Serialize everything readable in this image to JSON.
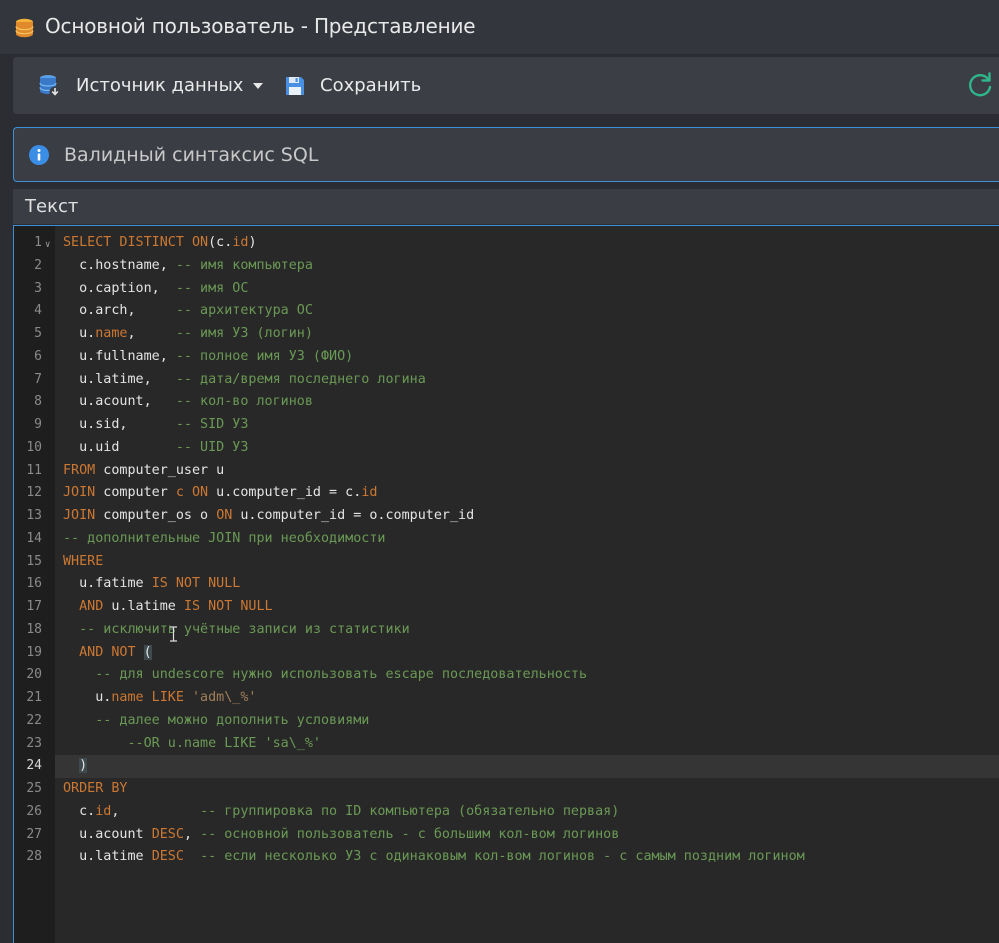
{
  "window": {
    "title": "Основной пользователь - Представление"
  },
  "toolbar": {
    "source_label": "Источник данных",
    "save_label": "Сохранить"
  },
  "info": {
    "message": "Валидный синтаксис SQL"
  },
  "panel": {
    "title": "Текст"
  },
  "editor": {
    "active_line": 24,
    "lines": [
      [
        [
          "kw",
          "SELECT DISTINCT ON"
        ],
        [
          "",
          "(c."
        ],
        [
          "kw",
          "id"
        ],
        [
          "",
          ")"
        ]
      ],
      [
        [
          "",
          "  c.hostname, "
        ],
        [
          "cm",
          "-- имя компьютера"
        ]
      ],
      [
        [
          "",
          "  o.caption,  "
        ],
        [
          "cm",
          "-- имя ОС"
        ]
      ],
      [
        [
          "",
          "  o.arch,     "
        ],
        [
          "cm",
          "-- архитектура ОС"
        ]
      ],
      [
        [
          "",
          "  u."
        ],
        [
          "kw",
          "name"
        ],
        [
          "",
          ",     "
        ],
        [
          "cm",
          "-- имя УЗ (логин)"
        ]
      ],
      [
        [
          "",
          "  u.fullname, "
        ],
        [
          "cm",
          "-- полное имя УЗ (ФИО)"
        ]
      ],
      [
        [
          "",
          "  u.latime,   "
        ],
        [
          "cm",
          "-- дата/время последнего логина"
        ]
      ],
      [
        [
          "",
          "  u.acount,   "
        ],
        [
          "cm",
          "-- кол-во логинов"
        ]
      ],
      [
        [
          "",
          "  u.sid,      "
        ],
        [
          "cm",
          "-- SID УЗ"
        ]
      ],
      [
        [
          "",
          "  u.uid       "
        ],
        [
          "cm",
          "-- UID УЗ"
        ]
      ],
      [
        [
          "kw",
          "FROM"
        ],
        [
          "",
          " computer_user u"
        ]
      ],
      [
        [
          "kw",
          "JOIN"
        ],
        [
          "",
          " computer "
        ],
        [
          "kw",
          "c ON"
        ],
        [
          "",
          " u.computer_id = c."
        ],
        [
          "kw",
          "id"
        ]
      ],
      [
        [
          "kw",
          "JOIN"
        ],
        [
          "",
          " computer_os o "
        ],
        [
          "kw",
          "ON"
        ],
        [
          "",
          " u.computer_id = o.computer_id"
        ]
      ],
      [
        [
          "cm",
          "-- дополнительные JOIN при необходимости"
        ]
      ],
      [
        [
          "kw",
          "WHERE"
        ]
      ],
      [
        [
          "",
          "  u.fatime "
        ],
        [
          "kw",
          "IS NOT NULL"
        ]
      ],
      [
        [
          "",
          "  "
        ],
        [
          "kw",
          "AND"
        ],
        [
          "",
          " u.latime "
        ],
        [
          "kw",
          "IS NOT NULL"
        ]
      ],
      [
        [
          "",
          "  "
        ],
        [
          "cm",
          "-- исключить учётные записи из статистики"
        ]
      ],
      [
        [
          "",
          "  "
        ],
        [
          "kw",
          "AND NOT"
        ],
        [
          "",
          " "
        ],
        [
          "br",
          "("
        ]
      ],
      [
        [
          "",
          "    "
        ],
        [
          "cm",
          "-- для undescore нужно использовать escape последовательность"
        ]
      ],
      [
        [
          "",
          "    u."
        ],
        [
          "kw",
          "name LIKE"
        ],
        [
          "",
          " "
        ],
        [
          "st",
          "'adm\\_%'"
        ]
      ],
      [
        [
          "",
          "    "
        ],
        [
          "cm",
          "-- далее можно дополнить условиями"
        ]
      ],
      [
        [
          "",
          "        "
        ],
        [
          "cm",
          "--OR u.name LIKE 'sa\\_%'"
        ]
      ],
      [
        [
          "",
          "  "
        ],
        [
          "br",
          ")"
        ]
      ],
      [
        [
          "kw",
          "ORDER BY"
        ]
      ],
      [
        [
          "",
          "  c."
        ],
        [
          "kw",
          "id"
        ],
        [
          "",
          ",          "
        ],
        [
          "cm",
          "-- группировка по ID компьютера (обязательно первая)"
        ]
      ],
      [
        [
          "",
          "  u.acount "
        ],
        [
          "kw",
          "DESC"
        ],
        [
          "",
          ", "
        ],
        [
          "cm",
          "-- основной пользователь - с большим кол-вом логинов"
        ]
      ],
      [
        [
          "",
          "  u.latime "
        ],
        [
          "kw",
          "DESC"
        ],
        [
          "",
          "  "
        ],
        [
          "cm",
          "-- если несколько УЗ с одинаковым кол-вом логинов - с самым поздним логином"
        ]
      ]
    ]
  }
}
